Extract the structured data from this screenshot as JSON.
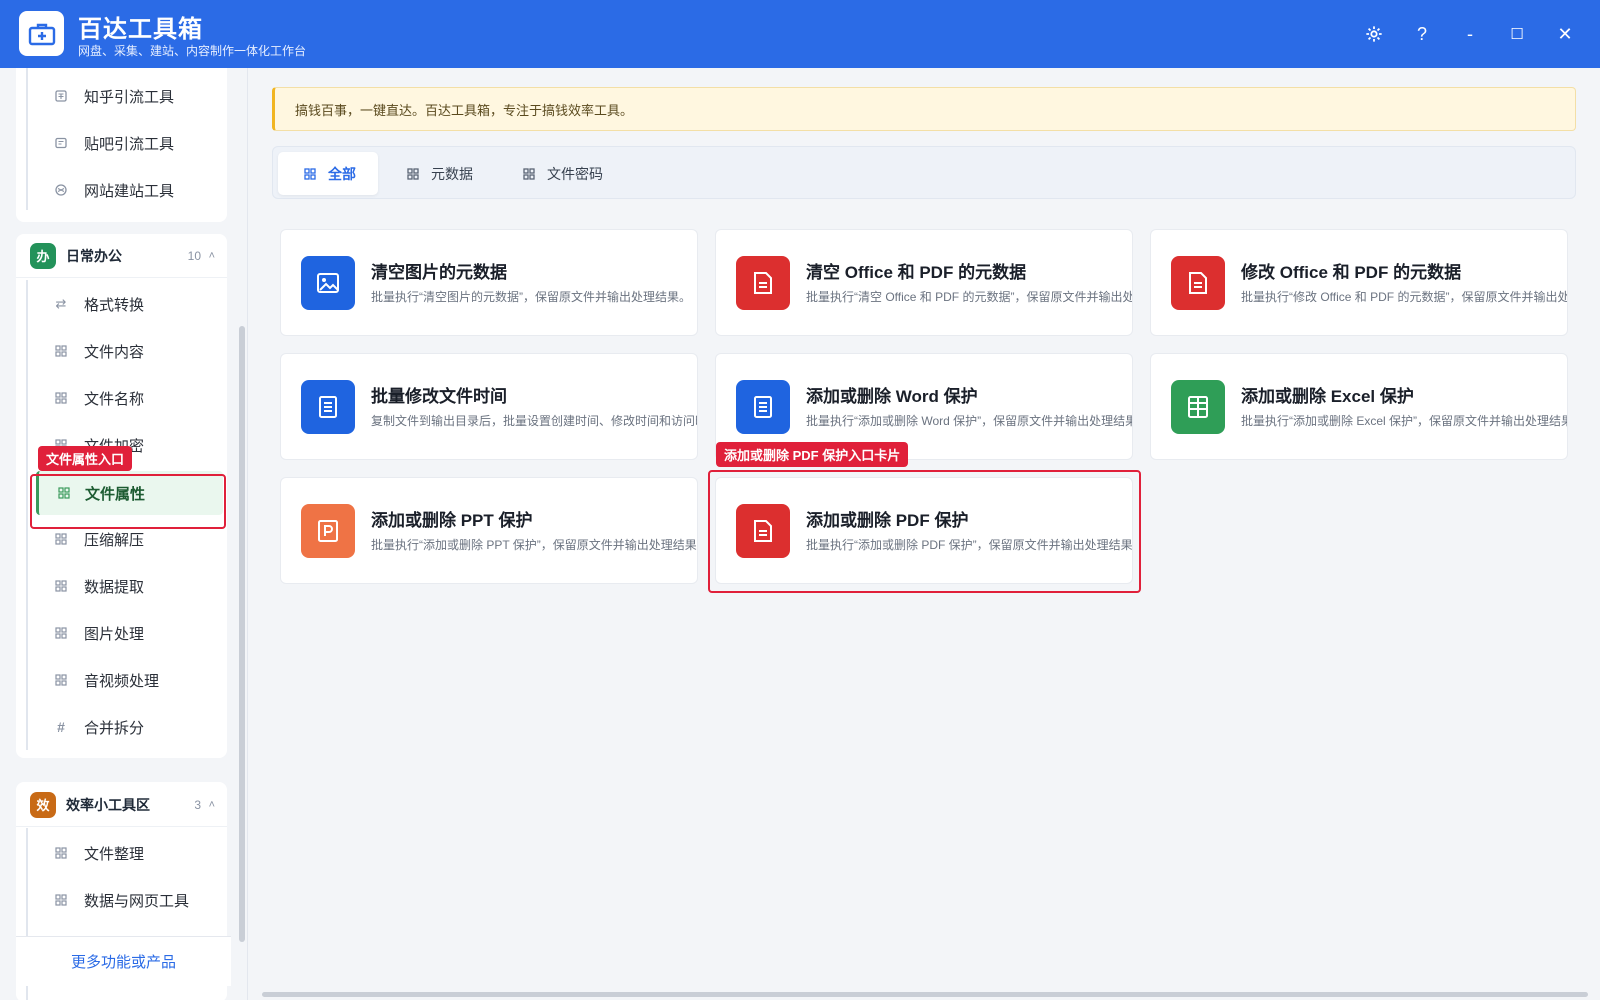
{
  "app": {
    "title": "百达工具箱",
    "subtitle": "网盘、采集、建站、内容制作一体化工作台"
  },
  "window_controls": {
    "settings": "⚙",
    "help": "?",
    "minimize": "-",
    "maximize": "☐",
    "close": "✕"
  },
  "sidebar": {
    "top_items": [
      {
        "label": "知乎引流工具",
        "icon": "zhihu-icon"
      },
      {
        "label": "贴吧引流工具",
        "icon": "tieba-icon"
      },
      {
        "label": "网站建站工具",
        "icon": "website-icon"
      }
    ],
    "groups": [
      {
        "badge": "办",
        "badge_color": "#23925a",
        "title": "日常办公",
        "count": "10",
        "caret": "˄",
        "items": [
          {
            "label": "格式转换",
            "icon": "swap-icon"
          },
          {
            "label": "文件内容",
            "icon": "grid-icon"
          },
          {
            "label": "文件名称",
            "icon": "grid-icon"
          },
          {
            "label": "文件加密",
            "icon": "grid-icon"
          },
          {
            "label": "文件属性",
            "icon": "grid-icon"
          },
          {
            "label": "压缩解压",
            "icon": "grid-icon"
          },
          {
            "label": "数据提取",
            "icon": "grid-icon"
          },
          {
            "label": "图片处理",
            "icon": "grid-icon"
          },
          {
            "label": "音视频处理",
            "icon": "grid-icon"
          },
          {
            "label": "合并拆分",
            "icon": "hash-icon"
          }
        ]
      },
      {
        "badge": "效",
        "badge_color": "#c86a16",
        "title": "效率小工具区",
        "count": "3",
        "caret": "˄",
        "items": [
          {
            "label": "文件整理",
            "icon": "grid-icon"
          },
          {
            "label": "数据与网页工具",
            "icon": "grid-icon"
          }
        ]
      }
    ],
    "more_label": "更多功能或产品"
  },
  "annotations": {
    "file_attr": "文件属性入口",
    "pdf_card": "添加或删除 PDF 保护入口卡片"
  },
  "notice": "搞钱百事，一键直达。百达工具箱，专注于搞钱效率工具。",
  "tabs": [
    {
      "label": "全部",
      "active": true
    },
    {
      "label": "元数据",
      "active": false
    },
    {
      "label": "文件密码",
      "active": false
    }
  ],
  "cards": [
    {
      "title": "清空图片的元数据",
      "desc": "批量执行“清空图片的元数据”，保留原文件并输出处理结果。",
      "color": "#1f64e0",
      "icon": "image-icon"
    },
    {
      "title": "清空 Office 和 PDF 的元数据",
      "desc": "批量执行“清空 Office 和 PDF 的元数据”，保留原文件并输出处理结果。",
      "color": "#dc2f2f",
      "icon": "document-icon"
    },
    {
      "title": "修改 Office 和 PDF 的元数据",
      "desc": "批量执行“修改 Office 和 PDF 的元数据”，保留原文件并输出处理结果。",
      "color": "#dc2f2f",
      "icon": "document-icon"
    },
    {
      "title": "批量修改文件时间",
      "desc": "复制文件到输出目录后，批量设置创建时间、修改时间和访问时间。",
      "color": "#1f64e0",
      "icon": "doc-lines-icon"
    },
    {
      "title": "添加或删除 Word 保护",
      "desc": "批量执行“添加或删除 Word 保护”，保留原文件并输出处理结果。",
      "color": "#1f64e0",
      "icon": "doc-lines-icon"
    },
    {
      "title": "添加或删除 Excel 保护",
      "desc": "批量执行“添加或删除 Excel 保护”，保留原文件并输出处理结果。",
      "color": "#2f9e57",
      "icon": "table-icon"
    },
    {
      "title": "添加或删除 PPT 保护",
      "desc": "批量执行“添加或删除 PPT 保护”，保留原文件并输出处理结果。",
      "color": "#ef7345",
      "icon": "ppt-icon"
    },
    {
      "title": "添加或删除 PDF 保护",
      "desc": "批量执行“添加或删除 PDF 保护”，保留原文件并输出处理结果。",
      "color": "#dc2f2f",
      "icon": "document-icon"
    }
  ]
}
